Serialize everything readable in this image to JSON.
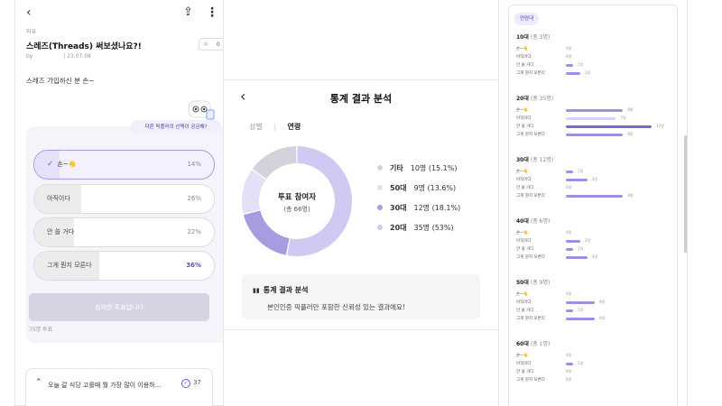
{
  "post": {
    "category": "자유",
    "title": "스레즈(Threads) 써보셨나요?!",
    "bookmark_count": "0",
    "author_prefix": "by",
    "date": "| 23.07.08",
    "body": "스레즈 가입하신 분 손~",
    "tooltip": "다른 픽플러의 선택이 궁금해?",
    "poll": {
      "options": [
        {
          "label": "손~👋",
          "pct": "14%",
          "value": 14,
          "selected": true
        },
        {
          "label": "아직이다",
          "pct": "26%",
          "value": 26
        },
        {
          "label": "안 쓸 거다",
          "pct": "22%",
          "value": 22
        },
        {
          "label": "그게 뭔지 모른다",
          "pct": "36%",
          "value": 36,
          "top": true
        }
      ],
      "button_label": "참여한 투표입니다",
      "vote_count": "75명 투표"
    },
    "related": {
      "question": "오늘 갈 식당 고를때 뭘 가장 많이 이용하...",
      "count": "37",
      "icon": "check-circle-icon"
    }
  },
  "stats": {
    "title": "통계 결과 분석",
    "tab_gender": "성별",
    "tab_age": "연령",
    "center_title": "투표 참여자",
    "center_sub": "(총 66명)",
    "legend": [
      {
        "name": "기타",
        "value": "10명 (15.1%)",
        "color": "#d3d3dc"
      },
      {
        "name": "50대",
        "value": "9명 (13.6%)",
        "color": "#e4e0f7"
      },
      {
        "name": "30대",
        "value": "12명 (18.1%)",
        "color": "#a99be0"
      },
      {
        "name": "20대",
        "value": "35명 (53%)",
        "color": "#d2c9f3"
      }
    ],
    "info_title": "통계 결과 분석",
    "info_body": "본인인증 픽플러만 포함한 신뢰성 있는 결과에요!"
  },
  "chart_data": {
    "type": "pie",
    "categories": [
      "20대",
      "30대",
      "50대",
      "기타"
    ],
    "values": [
      35,
      12,
      9,
      10
    ],
    "colors": [
      "#d2c9f3",
      "#a99be0",
      "#e4e0f7",
      "#d3d3dc"
    ]
  },
  "age": {
    "chip": "연령대",
    "groups": [
      {
        "name": "10대",
        "count": "(총 3명)",
        "rows": [
          {
            "label": "손~👋",
            "val": "0명",
            "n": 0
          },
          {
            "label": "아직이다",
            "val": "0명",
            "n": 0
          },
          {
            "label": "안 쓸 거다",
            "val": "1명",
            "n": 1
          },
          {
            "label": "그게 뭔지 모른다",
            "val": "2명",
            "n": 2
          }
        ]
      },
      {
        "name": "20대",
        "count": "(총 35명)",
        "rows": [
          {
            "label": "손~👋",
            "val": "8명",
            "n": 8
          },
          {
            "label": "아직이다",
            "val": "7명",
            "n": 7,
            "light": true
          },
          {
            "label": "안 쓸 거다",
            "val": "12명",
            "n": 12,
            "dark": true
          },
          {
            "label": "그게 뭔지 모른다",
            "val": "8명",
            "n": 8
          }
        ]
      },
      {
        "name": "30대",
        "count": "(총 12명)",
        "rows": [
          {
            "label": "손~👋",
            "val": "1명",
            "n": 1
          },
          {
            "label": "아직이다",
            "val": "3명",
            "n": 3
          },
          {
            "label": "안 쓸 거다",
            "val": "0명",
            "n": 0
          },
          {
            "label": "그게 뭔지 모른다",
            "val": "8명",
            "n": 8
          }
        ]
      },
      {
        "name": "40대",
        "count": "(총 6명)",
        "rows": [
          {
            "label": "손~👋",
            "val": "0명",
            "n": 0
          },
          {
            "label": "아직이다",
            "val": "2명",
            "n": 2
          },
          {
            "label": "안 쓸 거다",
            "val": "1명",
            "n": 1
          },
          {
            "label": "그게 뭔지 모른다",
            "val": "3명",
            "n": 3
          }
        ]
      },
      {
        "name": "50대",
        "count": "(총 9명)",
        "rows": [
          {
            "label": "손~👋",
            "val": "0명",
            "n": 0
          },
          {
            "label": "아직이다",
            "val": "4명",
            "n": 4
          },
          {
            "label": "안 쓸 거다",
            "val": "1명",
            "n": 1
          },
          {
            "label": "그게 뭔지 모른다",
            "val": "4명",
            "n": 4
          }
        ]
      },
      {
        "name": "60대",
        "count": "(총 1명)",
        "rows": [
          {
            "label": "손~👋",
            "val": "0명",
            "n": 0
          },
          {
            "label": "아직이다",
            "val": "1명",
            "n": 1
          },
          {
            "label": "안 쓸 거다",
            "val": "0명",
            "n": 0
          },
          {
            "label": "그게 뭔지 모른다",
            "val": "0명",
            "n": 0
          }
        ]
      }
    ]
  }
}
